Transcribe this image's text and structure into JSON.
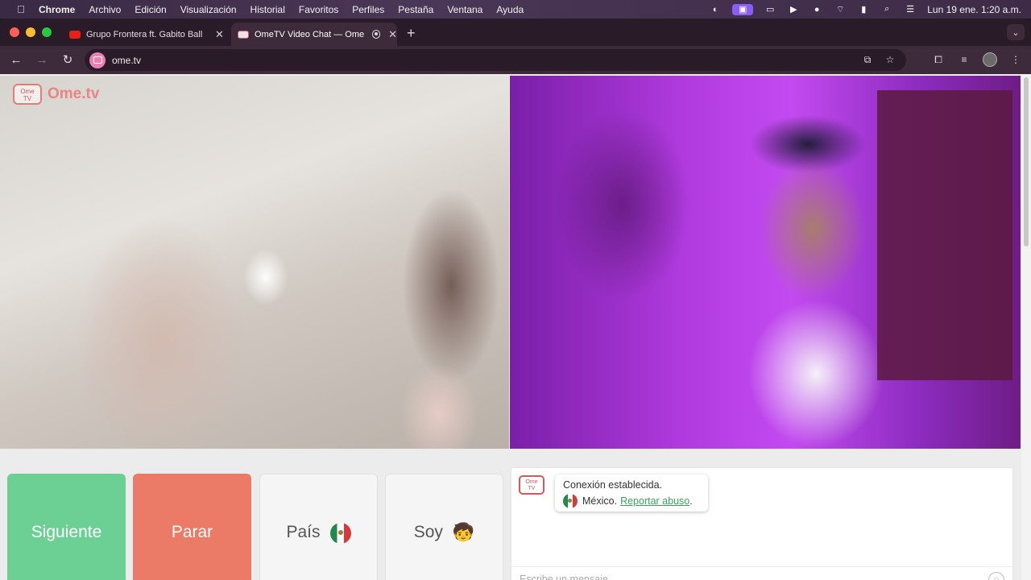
{
  "menubar": {
    "apple": "",
    "items": [
      "Chrome",
      "Archivo",
      "Edición",
      "Visualización",
      "Historial",
      "Favoritos",
      "Perfiles",
      "Pestaña",
      "Ventana",
      "Ayuda"
    ],
    "clock": "Lun 19 ene.  1:20 a.m."
  },
  "tabs": [
    {
      "title": "Grupo Frontera ft. Gabito Ball",
      "favicon": "youtube-icon"
    },
    {
      "title": "OmeTV Video Chat — Ome",
      "favicon": "ometv-icon"
    }
  ],
  "toolbar": {
    "url": "ome.tv"
  },
  "logo": {
    "tv_text": "Ome\nTV",
    "word": "Ome.tv"
  },
  "buttons": {
    "next": "Siguiente",
    "stop": "Parar",
    "country": "País",
    "me": "Soy",
    "me_emoji": "🧒"
  },
  "chat": {
    "logo_text": "Ome\nTV",
    "status": "Conexión establecida.",
    "country": "México.",
    "report": "Reportar abuso",
    "report_suffix": ".",
    "placeholder": "Escribe un mensaje"
  }
}
